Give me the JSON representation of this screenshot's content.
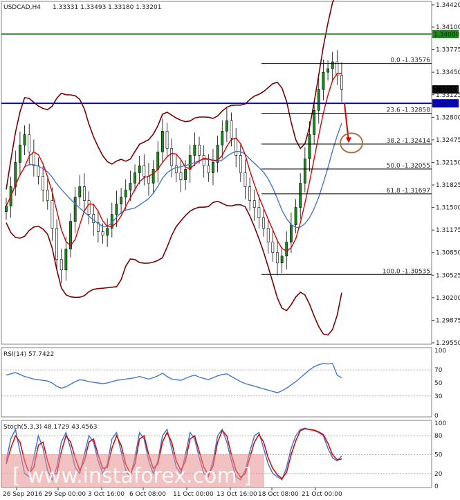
{
  "header": {
    "symbol": "USDCAD,H4",
    "ohlc": "1.33331 1.33493 1.33180 1.33201"
  },
  "chart_data": [
    {
      "type": "candlestick",
      "title": "USDCAD,H4",
      "ylim": [
        1.2955,
        1.3445
      ],
      "y_ticks": [
        "1.34420",
        "1.34100",
        "1.33775",
        "1.33450",
        "1.33125",
        "1.32800",
        "1.32475",
        "1.32150",
        "1.31825",
        "1.31500",
        "1.31175",
        "1.30850",
        "1.30525",
        "1.30200",
        "1.29875",
        "1.29550"
      ],
      "x_ticks": [
        "26 Sep 2016",
        "29 Sep 00:00",
        "3 Oct 16:00",
        "6 Oct 08:00",
        "11 Oct 00:00",
        "13 Oct 16:00",
        "18 Oct 08:00",
        "21 Oct 00:00"
      ],
      "close": [
        1.3152,
        1.318,
        1.3215,
        1.324,
        1.3255,
        1.323,
        1.321,
        1.3195,
        1.3175,
        1.316,
        1.312,
        1.3075,
        1.306,
        1.309,
        1.313,
        1.3165,
        1.318,
        1.316,
        1.314,
        1.3128,
        1.3115,
        1.311,
        1.312,
        1.314,
        1.3155,
        1.3165,
        1.3175,
        1.3185,
        1.32,
        1.321,
        1.3195,
        1.3185,
        1.3205,
        1.323,
        1.326,
        1.3235,
        1.321,
        1.32,
        1.319,
        1.3205,
        1.3225,
        1.324,
        1.3225,
        1.321,
        1.32,
        1.3215,
        1.324,
        1.326,
        1.3275,
        1.325,
        1.3225,
        1.32,
        1.318,
        1.316,
        1.315,
        1.3135,
        1.312,
        1.31,
        1.3085,
        1.307,
        1.308,
        1.31,
        1.3125,
        1.315,
        1.3185,
        1.322,
        1.3255,
        1.329,
        1.332,
        1.3345,
        1.335,
        1.336,
        1.334,
        1.332
      ],
      "lines": [
        {
          "name": "current_price",
          "value": 1.33201,
          "label": "1.33201"
        },
        {
          "name": "resistance",
          "value": 1.34,
          "label": "1.34000",
          "color": "#1a8a1a"
        },
        {
          "name": "support",
          "value": 1.33001,
          "label": "1.33001",
          "color": "#0000cc"
        }
      ],
      "fibonacci": [
        {
          "level": "0.0",
          "value": 1.33576,
          "label": "0.0 -1.33576"
        },
        {
          "level": "23.6",
          "value": 1.32858,
          "label": "23.6 -1.32858"
        },
        {
          "level": "38.2",
          "value": 1.32414,
          "label": "38.2 -1.32414"
        },
        {
          "level": "50.0",
          "value": 1.32055,
          "label": "50.0 -1.32055"
        },
        {
          "level": "61.8",
          "value": 1.31697,
          "label": "61.8 -1.31697"
        },
        {
          "level": "100.0",
          "value": 1.30535,
          "label": "100.0 -1.30535"
        }
      ],
      "colors": {
        "bull": "#1a8a1a",
        "bear": "#000000",
        "ma_fast": "#dd0000",
        "ma_slow": "#4477cc",
        "bands": "#7a0000",
        "target": "#b07040"
      }
    },
    {
      "type": "line",
      "title": "RSI(14) 57.7422",
      "ylim": [
        0,
        100
      ],
      "y_ticks": [
        "100",
        "70",
        "50",
        "30",
        "0"
      ],
      "values": [
        62,
        64,
        66,
        63,
        60,
        58,
        56,
        55,
        54,
        53,
        50,
        45,
        42,
        44,
        48,
        52,
        55,
        54,
        52,
        51,
        50,
        49,
        50,
        52,
        54,
        55,
        56,
        57,
        58,
        60,
        58,
        56,
        58,
        61,
        65,
        60,
        56,
        55,
        54,
        57,
        60,
        62,
        59,
        57,
        55,
        58,
        61,
        63,
        64,
        60,
        56,
        52,
        49,
        47,
        45,
        43,
        41,
        39,
        37,
        35,
        38,
        42,
        47,
        52,
        58,
        64,
        70,
        75,
        78,
        80,
        79,
        80,
        62,
        58
      ]
    },
    {
      "type": "line",
      "title": "Stoch(5,3,3) 48.1729 43.4563",
      "ylim": [
        0,
        100
      ],
      "y_ticks": [
        "100",
        "80",
        "50",
        "20",
        "0"
      ],
      "series": [
        {
          "name": "main",
          "values": [
            40,
            75,
            90,
            55,
            20,
            15,
            45,
            80,
            60,
            25,
            10,
            30,
            70,
            85,
            60,
            30,
            20,
            50,
            80,
            70,
            40,
            20,
            35,
            75,
            85,
            55,
            25,
            15,
            45,
            85,
            75,
            40,
            20,
            40,
            80,
            90,
            60,
            30,
            20,
            50,
            85,
            75,
            45,
            20,
            15,
            40,
            80,
            90,
            70,
            40,
            15,
            10,
            25,
            55,
            80,
            85,
            60,
            35,
            20,
            15,
            10,
            30,
            60,
            80,
            90,
            92,
            90,
            88,
            85,
            80,
            60,
            45,
            40,
            48
          ]
        },
        {
          "name": "signal",
          "values": [
            35,
            60,
            80,
            70,
            40,
            20,
            30,
            65,
            70,
            40,
            18,
            20,
            55,
            80,
            70,
            45,
            25,
            40,
            70,
            75,
            50,
            28,
            30,
            60,
            80,
            65,
            35,
            20,
            35,
            75,
            80,
            50,
            28,
            35,
            70,
            85,
            70,
            40,
            25,
            40,
            75,
            80,
            55,
            30,
            18,
            32,
            70,
            88,
            80,
            50,
            25,
            14,
            20,
            45,
            70,
            82,
            70,
            45,
            28,
            18,
            12,
            22,
            50,
            72,
            88,
            91,
            90,
            89,
            86,
            82,
            68,
            50,
            42,
            43
          ]
        }
      ],
      "colors": {
        "main": "#4477cc",
        "signal": "#dd0000"
      }
    }
  ],
  "watermark": {
    "text": "[ www.instaforex.com ]"
  }
}
